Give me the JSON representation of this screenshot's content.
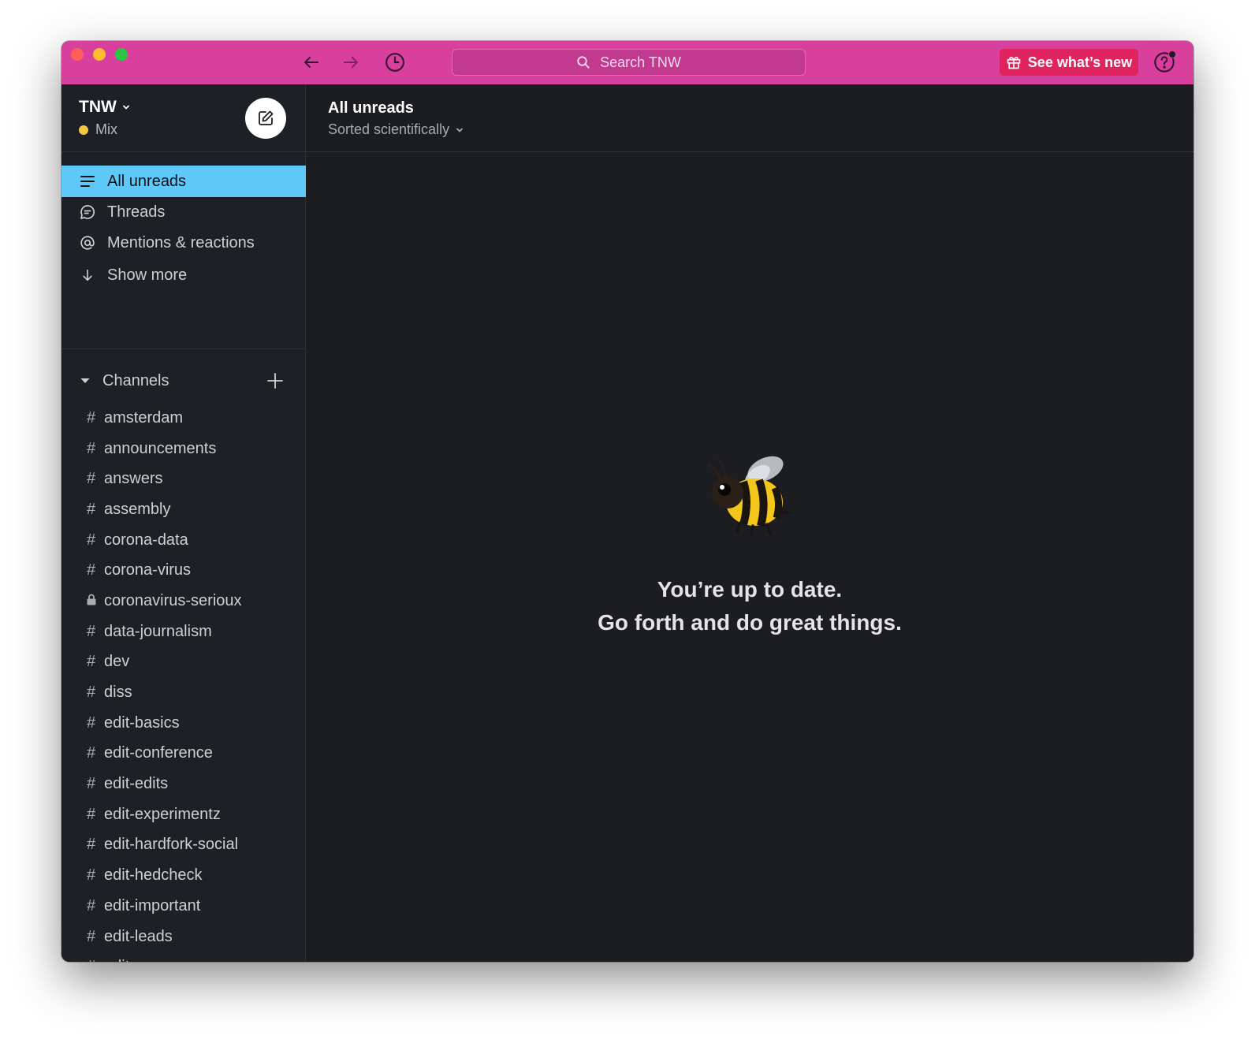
{
  "titlebar": {
    "search_placeholder": "Search TNW",
    "whats_new_label": "See what’s new",
    "accent_color": "#d9409e"
  },
  "workspace": {
    "name": "TNW",
    "status": "Mix",
    "status_color": "#f2c744"
  },
  "sidebar": {
    "nav": [
      {
        "label": "All unreads",
        "icon": "list-icon",
        "active": true
      },
      {
        "label": "Threads",
        "icon": "threads-icon",
        "active": false
      },
      {
        "label": "Mentions & reactions",
        "icon": "at-icon",
        "active": false
      },
      {
        "label": "Show more",
        "icon": "arrow-down-icon",
        "active": false
      }
    ],
    "channels_header": "Channels",
    "channels": [
      {
        "name": "amsterdam",
        "private": false
      },
      {
        "name": "announcements",
        "private": false
      },
      {
        "name": "answers",
        "private": false
      },
      {
        "name": "assembly",
        "private": false
      },
      {
        "name": "corona-data",
        "private": false
      },
      {
        "name": "corona-virus",
        "private": false
      },
      {
        "name": "coronavirus-serioux",
        "private": true
      },
      {
        "name": "data-journalism",
        "private": false
      },
      {
        "name": "dev",
        "private": false
      },
      {
        "name": "diss",
        "private": false
      },
      {
        "name": "edit-basics",
        "private": false
      },
      {
        "name": "edit-conference",
        "private": false
      },
      {
        "name": "edit-edits",
        "private": false
      },
      {
        "name": "edit-experimentz",
        "private": false
      },
      {
        "name": "edit-hardfork-social",
        "private": false
      },
      {
        "name": "edit-hedcheck",
        "private": false
      },
      {
        "name": "edit-important",
        "private": false
      },
      {
        "name": "edit-leads",
        "private": false
      },
      {
        "name": "edit-newsroom",
        "private": false
      }
    ],
    "active_color": "#5ec9f8"
  },
  "main": {
    "title": "All unreads",
    "sort_label": "Sorted scientifically",
    "empty_line1": "You’re up to date.",
    "empty_line2": "Go forth and do great things.",
    "illustration": "bee-icon"
  }
}
